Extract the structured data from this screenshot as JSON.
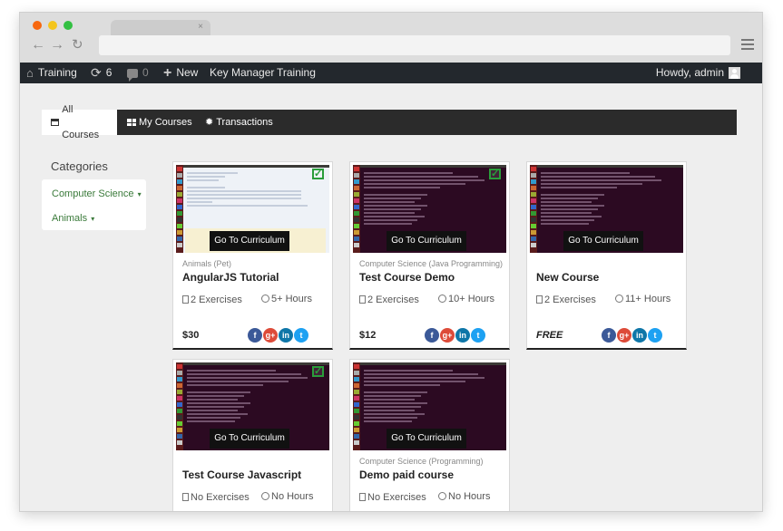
{
  "browser": {
    "tab_close": "×",
    "nav": {
      "back": "←",
      "forward": "→",
      "reload": "↻"
    }
  },
  "adminbar": {
    "site_name": "Training",
    "updates_count": "6",
    "comments_count": "0",
    "new_label": "New",
    "key_manager_label": "Key Manager",
    "training_label": "Training",
    "howdy_label": "Howdy, admin"
  },
  "course_tabs": [
    {
      "label": "All Courses",
      "active": true
    },
    {
      "label": "My Courses",
      "active": false
    },
    {
      "label": "Transactions",
      "active": false
    }
  ],
  "sidebar": {
    "title": "Categories",
    "items": [
      {
        "label": "Computer Science",
        "caret": "▾"
      },
      {
        "label": "Animals",
        "caret": "▾"
      }
    ]
  },
  "courses": [
    {
      "category": "Animals (Pet)",
      "title": "AngularJS Tutorial",
      "exercises": "2 Exercises",
      "hours": "5+ Hours",
      "price": "$30",
      "enrolled": true,
      "cta": "Go To Curriculum"
    },
    {
      "category": "Computer Science (Java Programming)",
      "title": "Test Course Demo",
      "exercises": "2 Exercises",
      "hours": "10+ Hours",
      "price": "$12",
      "enrolled": true,
      "cta": "Go To Curriculum"
    },
    {
      "category": "",
      "title": "New Course",
      "exercises": "2 Exercises",
      "hours": "11+ Hours",
      "price": "FREE",
      "enrolled": false,
      "cta": "Go To Curriculum"
    },
    {
      "category": "",
      "title": "Test Course Javascript",
      "exercises": "No Exercises",
      "hours": "No Hours",
      "price": "",
      "enrolled": true,
      "cta": "Go To Curriculum"
    },
    {
      "category": "Computer Science (Programming)",
      "title": "Demo paid course",
      "exercises": "No Exercises",
      "hours": "No Hours",
      "price": "",
      "enrolled": false,
      "cta": "Go To Curriculum"
    }
  ],
  "social": {
    "facebook": "f",
    "google_plus": "g+",
    "linkedin": "in",
    "twitter": "t"
  },
  "colors": {
    "adminbar_bg": "#23282d",
    "tabsbar_bg": "#2b2b2b",
    "category_link": "#3a7a3a",
    "enrolled_check": "#2a9d3a",
    "thumb_terminal": "#2c0a22"
  }
}
